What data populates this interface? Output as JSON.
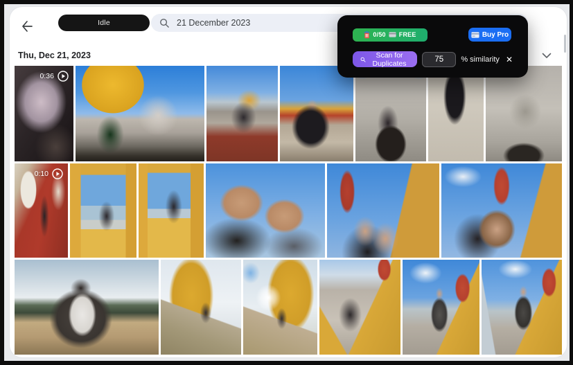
{
  "header": {
    "status_pill_label": "Idle",
    "search": {
      "value": "21 December 2023"
    }
  },
  "date_section": {
    "label": "Thu, Dec 21, 2023"
  },
  "overlay_panel": {
    "free_counter": {
      "count": "0/50",
      "label": "FREE"
    },
    "buy_pro_label": "Buy Pro",
    "scan_label": "Scan for Duplicates",
    "similarity_value": "75",
    "similarity_label": "% similarity",
    "close_label": "✕",
    "colors": {
      "panel_bg": "#0a0a0b",
      "green_gradient": [
        "#2eb350",
        "#1fae6e"
      ],
      "purple_gradient": [
        "#7d57e8",
        "#9a6ef0"
      ],
      "blue": "#1b6ef3"
    }
  },
  "grid": {
    "rows": [
      {
        "tiles": [
          {
            "desc": "dark indoor video of person resting on couch",
            "duration": "0:36"
          },
          {
            "desc": "wide view of Pena Palace with yellow dome, blue sky, christmas tree and visitors"
          },
          {
            "desc": "woman standing on red terrace with palace behind"
          },
          {
            "desc": "man in black coat sitting on stone wall, yellow and red palace behind"
          },
          {
            "desc": "man posing in front of carved stone archway"
          },
          {
            "desc": "person in long black coat seen from behind on gravel courtyard"
          },
          {
            "desc": "close-up of carved triton stone facade over dark archway"
          }
        ]
      },
      {
        "tiles": [
          {
            "desc": "video of person walking past red wall with white windows",
            "duration": "0:10"
          },
          {
            "desc": "woman sitting in yellow arched window with valley view"
          },
          {
            "desc": "woman seated on ledge of yellow arch against blue sky"
          },
          {
            "desc": "close selfie of man and woman wearing sunglasses"
          },
          {
            "desc": "selfie of couple with red clock tower and yellow facade behind"
          },
          {
            "desc": "couple kissing in front of palace towers and blue sky"
          }
        ]
      },
      {
        "tiles": [
          {
            "desc": "wide shot of woman with windblown hair on terrace above valley"
          },
          {
            "desc": "low-angle view of yellow palace tower against bright sky"
          },
          {
            "desc": "low-angle yellow palace with sun flare and blue sky"
          },
          {
            "desc": "man crouching on walkway between yellow walls"
          },
          {
            "desc": "woman in grey coat walking on walkway, red tower behind"
          },
          {
            "desc": "woman walking on walkway with red tower and hazy view"
          }
        ]
      }
    ]
  }
}
